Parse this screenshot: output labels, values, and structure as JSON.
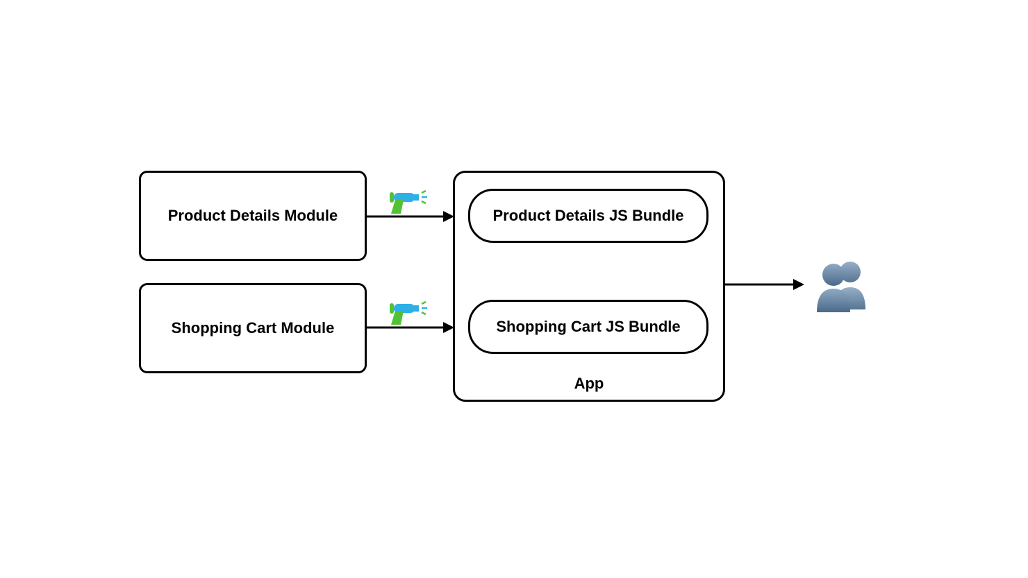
{
  "modules": {
    "productDetails": "Product Details Module",
    "shoppingCart": "Shopping Cart Module"
  },
  "bundles": {
    "productDetails": "Product Details JS Bundle",
    "shoppingCart": "Shopping Cart JS Bundle"
  },
  "app": {
    "label": "App"
  }
}
